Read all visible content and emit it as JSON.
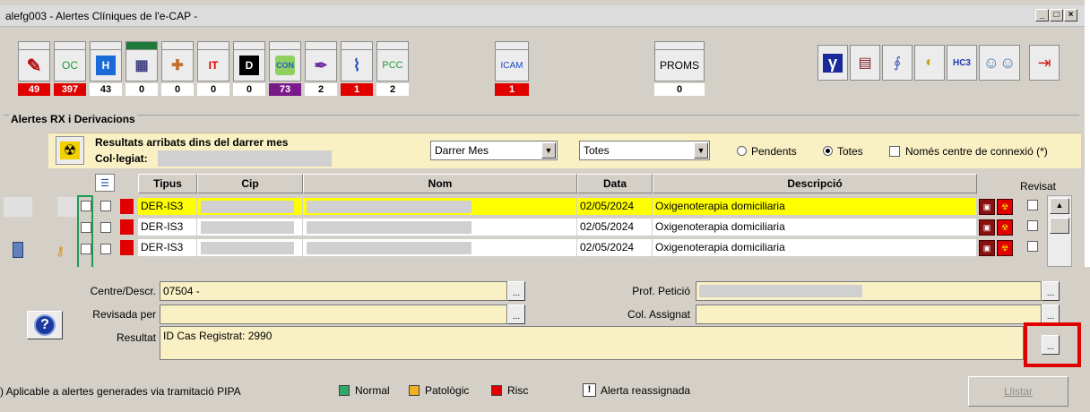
{
  "window": {
    "title": "alefg003 - Alertes Clíniques de l'e-CAP -",
    "min": "_",
    "max": "□",
    "close": "×"
  },
  "toolbar": {
    "tools": [
      {
        "icon": "test-tube-icon",
        "glyph": "✎",
        "count": "49",
        "count_style": "red"
      },
      {
        "icon": "oc-icon",
        "glyph": "OC",
        "count": "397",
        "count_style": "red"
      },
      {
        "icon": "h-icon",
        "glyph": "H",
        "count": "43",
        "count_style": "white"
      },
      {
        "icon": "calculator-icon",
        "glyph": "▦",
        "count": "0",
        "count_style": "white"
      },
      {
        "icon": "medkit-icon",
        "glyph": "✚",
        "count": "0",
        "count_style": "white"
      },
      {
        "icon": "it-icon",
        "glyph": "IT",
        "count": "0",
        "count_style": "white"
      },
      {
        "icon": "d-icon",
        "glyph": "D",
        "count": "0",
        "count_style": "white"
      },
      {
        "icon": "con-icon",
        "glyph": "CON",
        "count": "73",
        "count_style": "purple"
      },
      {
        "icon": "pen-icon",
        "glyph": "✒",
        "count": "2",
        "count_style": "white"
      },
      {
        "icon": "syringe-icon",
        "glyph": "⌇",
        "count": "1",
        "count_style": "red"
      },
      {
        "icon": "pcc-icon",
        "glyph": "PCC",
        "count": "2",
        "count_style": "white"
      }
    ],
    "icam": {
      "label": "ICAM",
      "count": "1"
    },
    "proms": {
      "label": "PROMS",
      "count": "0"
    },
    "right_icons": [
      "gamma-icon",
      "clipboard-icon",
      "stethoscope-icon",
      "pill-icon",
      "hc3-icon",
      "people-icon",
      "exit-door-icon"
    ],
    "hc3_label": "HC3"
  },
  "alerts": {
    "group_title": "Alertes RX i Derivacions",
    "summary_line1": "Resultats arribats dins del darrer mes",
    "summary_line2": "Col·legiat:",
    "period_select": "Darrer Mes",
    "type_select": "Totes",
    "radio_pendents": "Pendents",
    "radio_totes": "Totes",
    "checkbox_label": "Només centre de connexió (*)",
    "columns": [
      "Tipus",
      "Cip",
      "Nom",
      "Data",
      "Descripció",
      "Revisat"
    ],
    "rows": [
      {
        "tipus": "DER-IS3",
        "data": "02/05/2024",
        "descripcio": "Oxigenoterapia domiciliaria"
      },
      {
        "tipus": "DER-IS3",
        "data": "02/05/2024",
        "descripcio": "Oxigenoterapia domiciliaria"
      },
      {
        "tipus": "DER-IS3",
        "data": "02/05/2024",
        "descripcio": "Oxigenoterapia domiciliaria"
      }
    ]
  },
  "detail": {
    "centre_label": "Centre/Descr.",
    "centre_value": "07504 -",
    "revisada_label": "Revisada per",
    "revisada_value": "",
    "resultat_label": "Resultat",
    "resultat_value": "ID Cas Registrat: 2990",
    "prof_label": "Prof. Petició",
    "col_label": "Col. Assignat",
    "dots": "...",
    "help": "?"
  },
  "footer": {
    "note": ") Aplicable a alertes generades via tramitació PIPA",
    "legend": [
      {
        "label": "Normal",
        "color": "#2fa86a"
      },
      {
        "label": "Patològic",
        "color": "#f0b020"
      },
      {
        "label": "Risc",
        "color": "#e00000"
      }
    ],
    "reassign_icon": "!",
    "reassign_label": "Alerta reassignada",
    "listar": "Llistar"
  }
}
